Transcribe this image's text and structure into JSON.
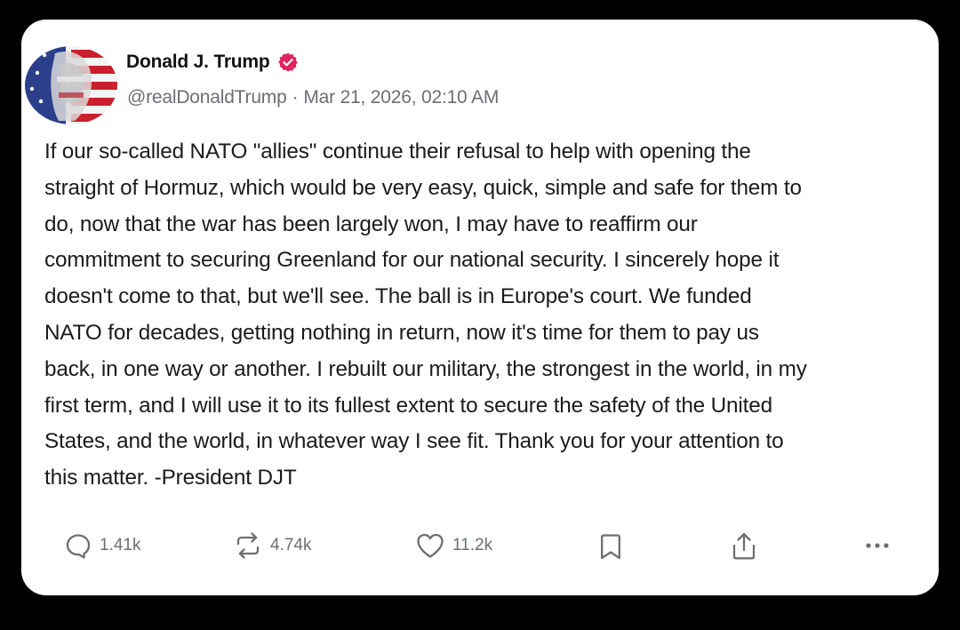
{
  "post": {
    "author_name": "Donald J. Trump",
    "verified_icon": "verified-badge-icon",
    "handle": "@realDonaldTrump",
    "separator": "·",
    "timestamp": "Mar 21, 2026, 02:10 AM",
    "body_lines": [
      "If our so-called NATO \"allies\" continue their refusal to help with opening the",
      "straight of Hormuz, which would be very easy, quick, simple and safe for them to",
      "do, now that the war has been largely won, I may have to reaffirm our",
      "commitment to securing Greenland for our national security. I sincerely hope it",
      "doesn't come to that, but we'll see. The ball is in Europe's court. We funded",
      "NATO for decades, getting nothing in return, now it's time for them to pay us",
      "back, in one way or another. I rebuilt our military, the strongest in the world, in my",
      "first term, and I will use it to its fullest extent to secure the safety of the United",
      "States, and the world, in whatever way I see fit. Thank you for your attention to",
      "this matter. -President DJT"
    ]
  },
  "actions": {
    "reply": {
      "icon": "reply-icon",
      "count": "1.41k"
    },
    "repost": {
      "icon": "repost-icon",
      "count": "4.74k"
    },
    "like": {
      "icon": "heart-icon",
      "count": "11.2k"
    },
    "bookmark": {
      "icon": "bookmark-icon"
    },
    "share": {
      "icon": "share-icon"
    },
    "more": {
      "icon": "more-icon"
    }
  },
  "colors": {
    "background": "#000000",
    "card": "#ffffff",
    "text": "#1b1b1b",
    "muted": "#6b6f74",
    "verified": "#e0245e"
  }
}
